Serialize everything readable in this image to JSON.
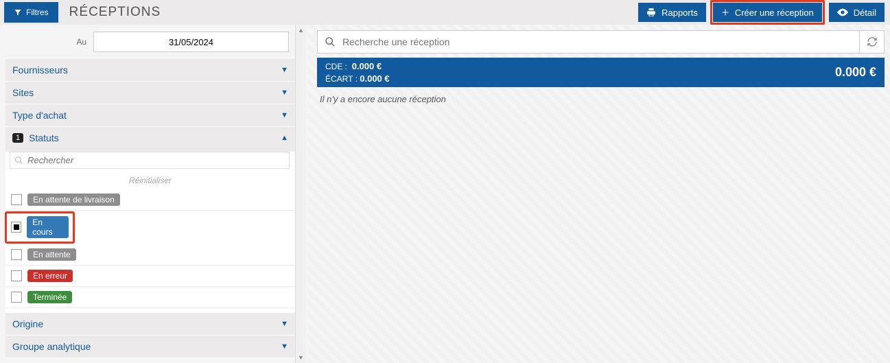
{
  "header": {
    "filters_label": "Filtres",
    "title": "RÉCEPTIONS",
    "reports_label": "Rapports",
    "create_label": "Créer une réception",
    "detail_label": "Détail"
  },
  "dates": {
    "to_label": "Au",
    "to_value": "31/05/2024"
  },
  "filters": {
    "suppliers": {
      "label": "Fournisseurs",
      "expanded": false
    },
    "sites": {
      "label": "Sites",
      "expanded": false
    },
    "purchase_type": {
      "label": "Type d'achat",
      "expanded": false
    },
    "statuses": {
      "label": "Statuts",
      "count": "1",
      "expanded": true,
      "search_placeholder": "Rechercher",
      "reset_label": "Réinitialiser",
      "items": [
        {
          "label": "En attente de livraison",
          "color": "grey",
          "checked": false
        },
        {
          "label": "En cours",
          "color": "blue",
          "checked": true,
          "highlighted": true
        },
        {
          "label": "En attente",
          "color": "grey",
          "checked": false
        },
        {
          "label": "En erreur",
          "color": "red",
          "checked": false
        },
        {
          "label": "Terminée",
          "color": "green",
          "checked": false
        }
      ]
    },
    "origin": {
      "label": "Origine",
      "expanded": false
    },
    "analytic_group": {
      "label": "Groupe analytique",
      "expanded": false
    }
  },
  "search": {
    "placeholder": "Recherche une réception"
  },
  "summary": {
    "cde_label": "CDE :",
    "cde_value": "0.000 €",
    "ecart_label": "ÉCART :",
    "ecart_value": "0.000 €",
    "total": "0.000 €"
  },
  "empty_message": "Il n'y a encore aucune réception"
}
